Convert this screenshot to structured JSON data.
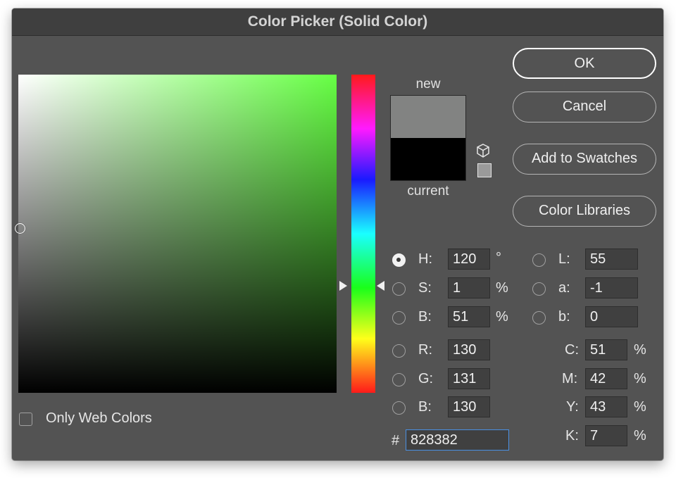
{
  "window": {
    "title": "Color Picker (Solid Color)"
  },
  "buttons": {
    "ok": "OK",
    "cancel": "Cancel",
    "add_to_swatches": "Add to Swatches",
    "color_libraries": "Color Libraries"
  },
  "preview": {
    "new_label": "new",
    "current_label": "current",
    "new_color": "#828382",
    "current_color": "#000000"
  },
  "hsb": {
    "h_label": "H:",
    "h_value": "120",
    "h_unit": "°",
    "s_label": "S:",
    "s_value": "1",
    "s_unit": "%",
    "b_label": "B:",
    "b_value": "51",
    "b_unit": "%",
    "selected": "H"
  },
  "rgb": {
    "r_label": "R:",
    "r_value": "130",
    "g_label": "G:",
    "g_value": "131",
    "b_label": "B:",
    "b_value": "130"
  },
  "lab": {
    "l_label": "L:",
    "l_value": "55",
    "a_label": "a:",
    "a_value": "-1",
    "b_label": "b:",
    "b_value": "0"
  },
  "cmyk": {
    "c_label": "C:",
    "c_value": "51",
    "m_label": "M:",
    "m_value": "42",
    "y_label": "Y:",
    "y_value": "43",
    "k_label": "K:",
    "k_value": "7",
    "unit": "%"
  },
  "hex": {
    "label": "#",
    "value": "828382"
  },
  "options": {
    "only_web_colors": "Only Web Colors",
    "only_web_colors_checked": false
  },
  "icons": {
    "gamut": "cube-icon",
    "websafe": "websafe-swatch-icon"
  }
}
